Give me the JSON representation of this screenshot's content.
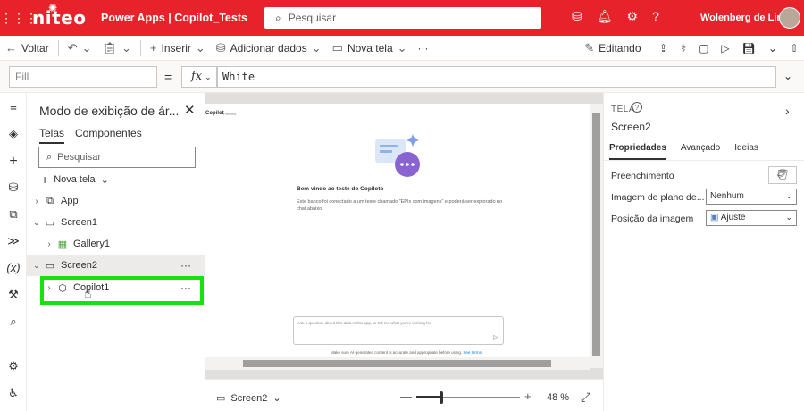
{
  "topbar": {
    "logo": "niteo",
    "app_title": "Power Apps  |  Copilot_Tests",
    "search_placeholder": "Pesquisar",
    "user_name": "Wolenberg de Lim..."
  },
  "command_bar": {
    "back": "Voltar",
    "insert": "Inserir",
    "add_data": "Adicionar dados",
    "new_screen": "Nova tela",
    "more": "···",
    "editing": "Editando"
  },
  "formula_bar": {
    "property": "Fill",
    "equals": "=",
    "fx": "fx",
    "formula": "White"
  },
  "tree_view": {
    "title": "Modo de exibição de ár...",
    "tabs": [
      "Telas",
      "Componentes"
    ],
    "search_placeholder": "Pesquisar",
    "new_screen": "Nova tela",
    "nodes": [
      {
        "label": "App"
      },
      {
        "label": "Screen1"
      },
      {
        "label": "Gallery1"
      },
      {
        "label": "Screen2"
      },
      {
        "label": "Copilot1"
      }
    ]
  },
  "canvas": {
    "control_label": "Copilot",
    "preview_tag": "Preview",
    "welcome_title": "Bem vindo ao teste do Copiloto",
    "description": "Este banco foi conectado a um teste chamado \"EPIs com imagens\" e poderá ser explorado no chat abaixo",
    "ask_placeholder": "Ask a question about this data in this app, or tell me what you're looking for",
    "disclaimer": "Make sure AI-generated content is accurate and appropriate before using.",
    "disclaimer_link": "See terms"
  },
  "bottom_bar": {
    "screen_selected": "Screen2",
    "zoom": "48  %",
    "zoom_level_percent": 48
  },
  "properties_panel": {
    "type": "TELA",
    "name": "Screen2",
    "tabs": [
      "Propriedades",
      "Avançado",
      "Ideias"
    ],
    "fill_label": "Preenchimento",
    "bg_image_label": "Imagem de plano de...",
    "bg_image_value": "Nenhum",
    "image_position_label": "Posição da imagem",
    "image_position_value": "Ajuste"
  },
  "colors": {
    "brand": "#e8222a",
    "highlight": "#16e30d",
    "copilot_accent": "#7b5cd6"
  }
}
